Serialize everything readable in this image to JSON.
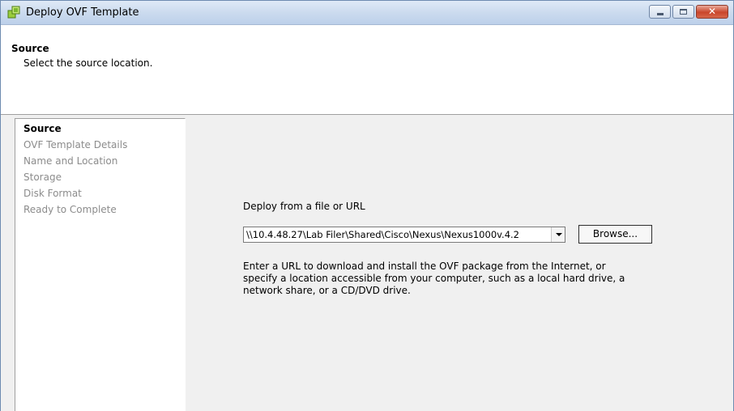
{
  "window": {
    "title": "Deploy OVF Template",
    "controls": {
      "minimize": "minimize",
      "maximize": "maximize",
      "close": "✕"
    }
  },
  "header": {
    "title": "Source",
    "subtitle": "Select the source location."
  },
  "steps": [
    {
      "label": "Source",
      "active": true
    },
    {
      "label": "OVF Template Details",
      "active": false
    },
    {
      "label": "Name and Location",
      "active": false
    },
    {
      "label": "Storage",
      "active": false
    },
    {
      "label": "Disk Format",
      "active": false
    },
    {
      "label": "Ready to Complete",
      "active": false
    }
  ],
  "source": {
    "label": "Deploy from a file or URL",
    "url_value": "\\\\10.4.48.27\\Lab Filer\\Shared\\Cisco\\Nexus\\Nexus1000v.4.2",
    "browse_label": "Browse...",
    "help_lines": [
      "Enter a URL to download and install the OVF package from the Internet, or",
      "specify a location accessible from your computer, such as a local hard drive, a",
      "network share, or a CD/DVD drive."
    ]
  },
  "colors": {
    "titlebar": "#cddcef",
    "panel": "#f0f0f0",
    "inactive_step": "#8c8c8c",
    "icon_green": "#7cb82f"
  }
}
